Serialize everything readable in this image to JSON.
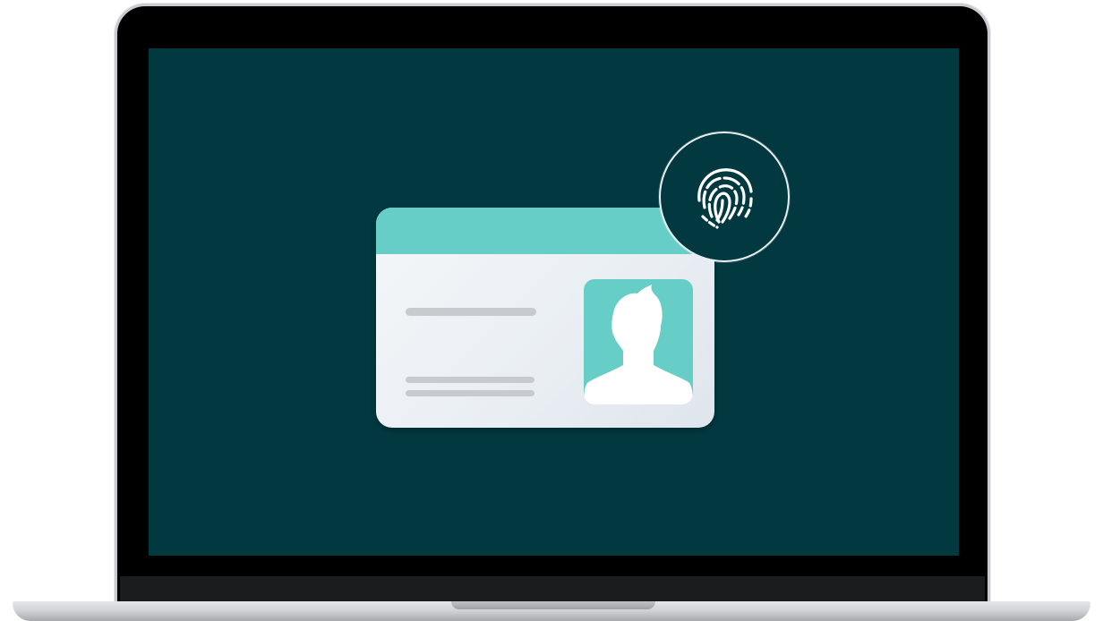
{
  "illustration": {
    "subject": "laptop",
    "screen_background": "#02383f",
    "accent": "#67cec7",
    "card_background": "#f4f7f9",
    "text_line_color": "#c7cbd0",
    "icons": [
      "id-card-icon",
      "person-avatar-icon",
      "fingerprint-icon"
    ]
  }
}
